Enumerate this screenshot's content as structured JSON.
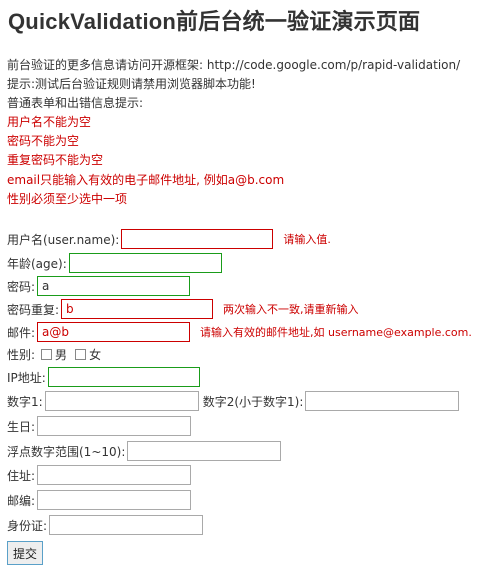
{
  "title": "QuickValidation前后台统一验证演示页面",
  "info": {
    "line1": "前台验证的更多信息请访问开源框架: http://code.google.com/p/rapid-validation/",
    "line2": "提示:测试后台验证规则请禁用浏览器脚本功能!",
    "line3": "普通表单和出错信息提示:"
  },
  "errors": [
    "用户名不能为空",
    "密码不能为空",
    "重复密码不能为空",
    "email只能输入有效的电子邮件地址, 例如a@b.com",
    "性别必须至少选中一项"
  ],
  "form": {
    "username": {
      "label": "用户名(user.name):",
      "value": "",
      "tip": "请输入值."
    },
    "age": {
      "label": "年龄(age):",
      "value": ""
    },
    "password": {
      "label": "密码:",
      "value": "a"
    },
    "password_repeat": {
      "label": "密码重复:",
      "value": "b",
      "tip": "两次输入不一致,请重新输入"
    },
    "email": {
      "label": "邮件:",
      "value": "a@b",
      "tip": "请输入有效的邮件地址,如 username@example.com."
    },
    "gender": {
      "label": "性别:",
      "male": "男",
      "female": "女"
    },
    "ip": {
      "label": "IP地址:",
      "value": ""
    },
    "num1": {
      "label": "数字1:",
      "value": ""
    },
    "num2": {
      "label": "数字2(小于数字1):",
      "value": ""
    },
    "birthday": {
      "label": "生日:",
      "value": ""
    },
    "float_range": {
      "label": "浮点数字范围(1~10):",
      "value": ""
    },
    "address": {
      "label": "住址:",
      "value": ""
    },
    "zipcode": {
      "label": "邮编:",
      "value": ""
    },
    "idcard": {
      "label": "身份证:",
      "value": ""
    },
    "submit_label": "提交"
  },
  "colors": {
    "error": "#cc0000",
    "valid_border": "#1a9c1a",
    "button_border": "#5aa0c8"
  }
}
